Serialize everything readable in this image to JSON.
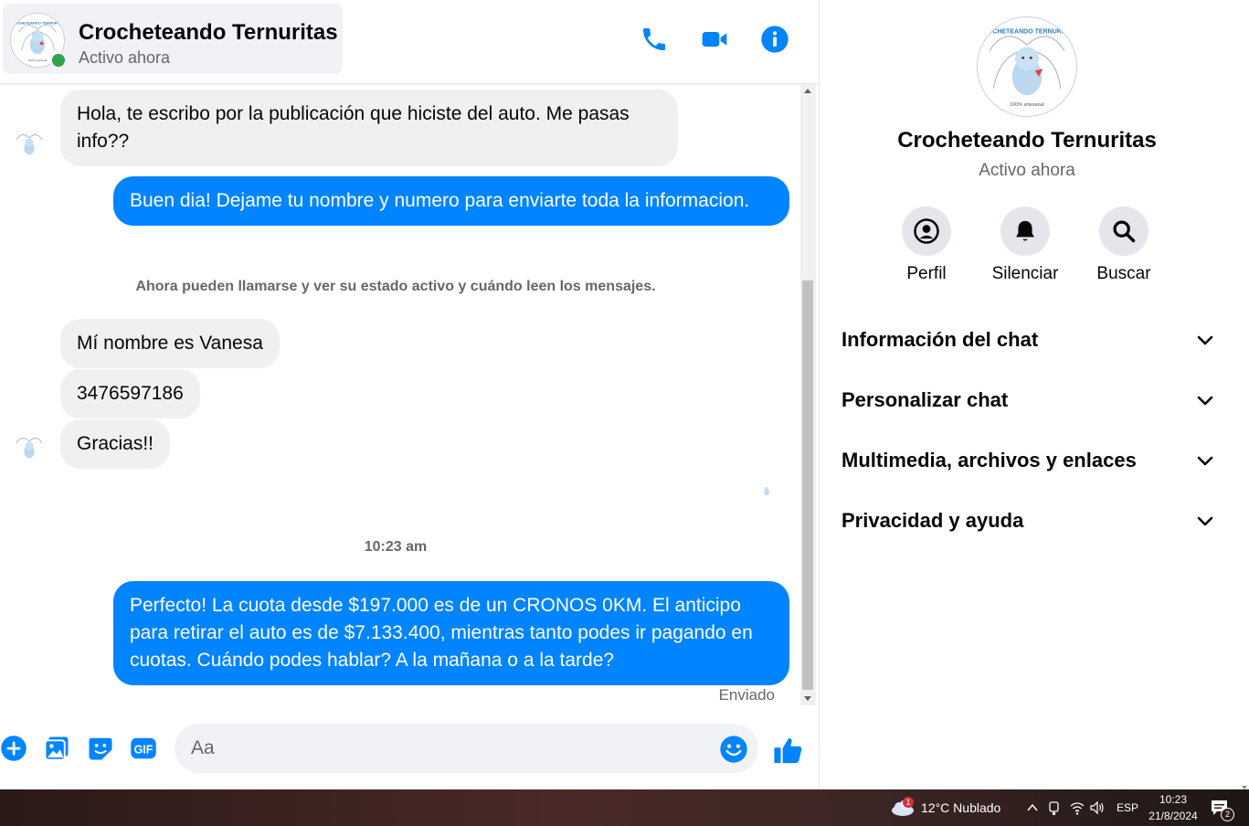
{
  "header": {
    "name": "Crocheteando Ternuritas",
    "status": "Activo ahora"
  },
  "messages": {
    "m1": "Hola, te escribo por la publicación que hiciste del auto. Me pasas info??",
    "m2": "Buen dia! Dejame tu nombre y numero para enviarte toda la informacion.",
    "notice": "Ahora pueden llamarse y ver su estado activo y cuándo leen los mensajes.",
    "m3": "Mí nombre es Vanesa",
    "m4": "3476597186",
    "m5": "Gracias!!",
    "time": "10:23 am",
    "m6": "Perfecto! La cuota desde $197.000 es de un CRONOS 0KM. El anticipo para retirar el auto es de $7.133.400, mientras tanto podes ir pagando en cuotas. Cuándo podes hablar? A la mañana o a la tarde?",
    "sent": "Enviado"
  },
  "composer": {
    "placeholder": "Aa"
  },
  "side": {
    "name": "Crocheteando Ternuritas",
    "status": "Activo ahora",
    "actions": {
      "profile": "Perfil",
      "mute": "Silenciar",
      "search": "Buscar"
    },
    "sections": [
      "Información del chat",
      "Personalizar chat",
      "Multimedia, archivos y enlaces",
      "Privacidad y ayuda"
    ]
  },
  "avatar_text": "CROCHETEANDO TERNURITAS",
  "avatar_caption": "100% artesanal",
  "taskbar": {
    "weather_badge": "1",
    "weather": "12°C  Nublado",
    "lang": "ESP",
    "clock_time": "10:23",
    "clock_date": "21/8/2024",
    "notifications": "2"
  },
  "colors": {
    "messenger_blue": "#0084ff",
    "online_green": "#31a24c"
  }
}
